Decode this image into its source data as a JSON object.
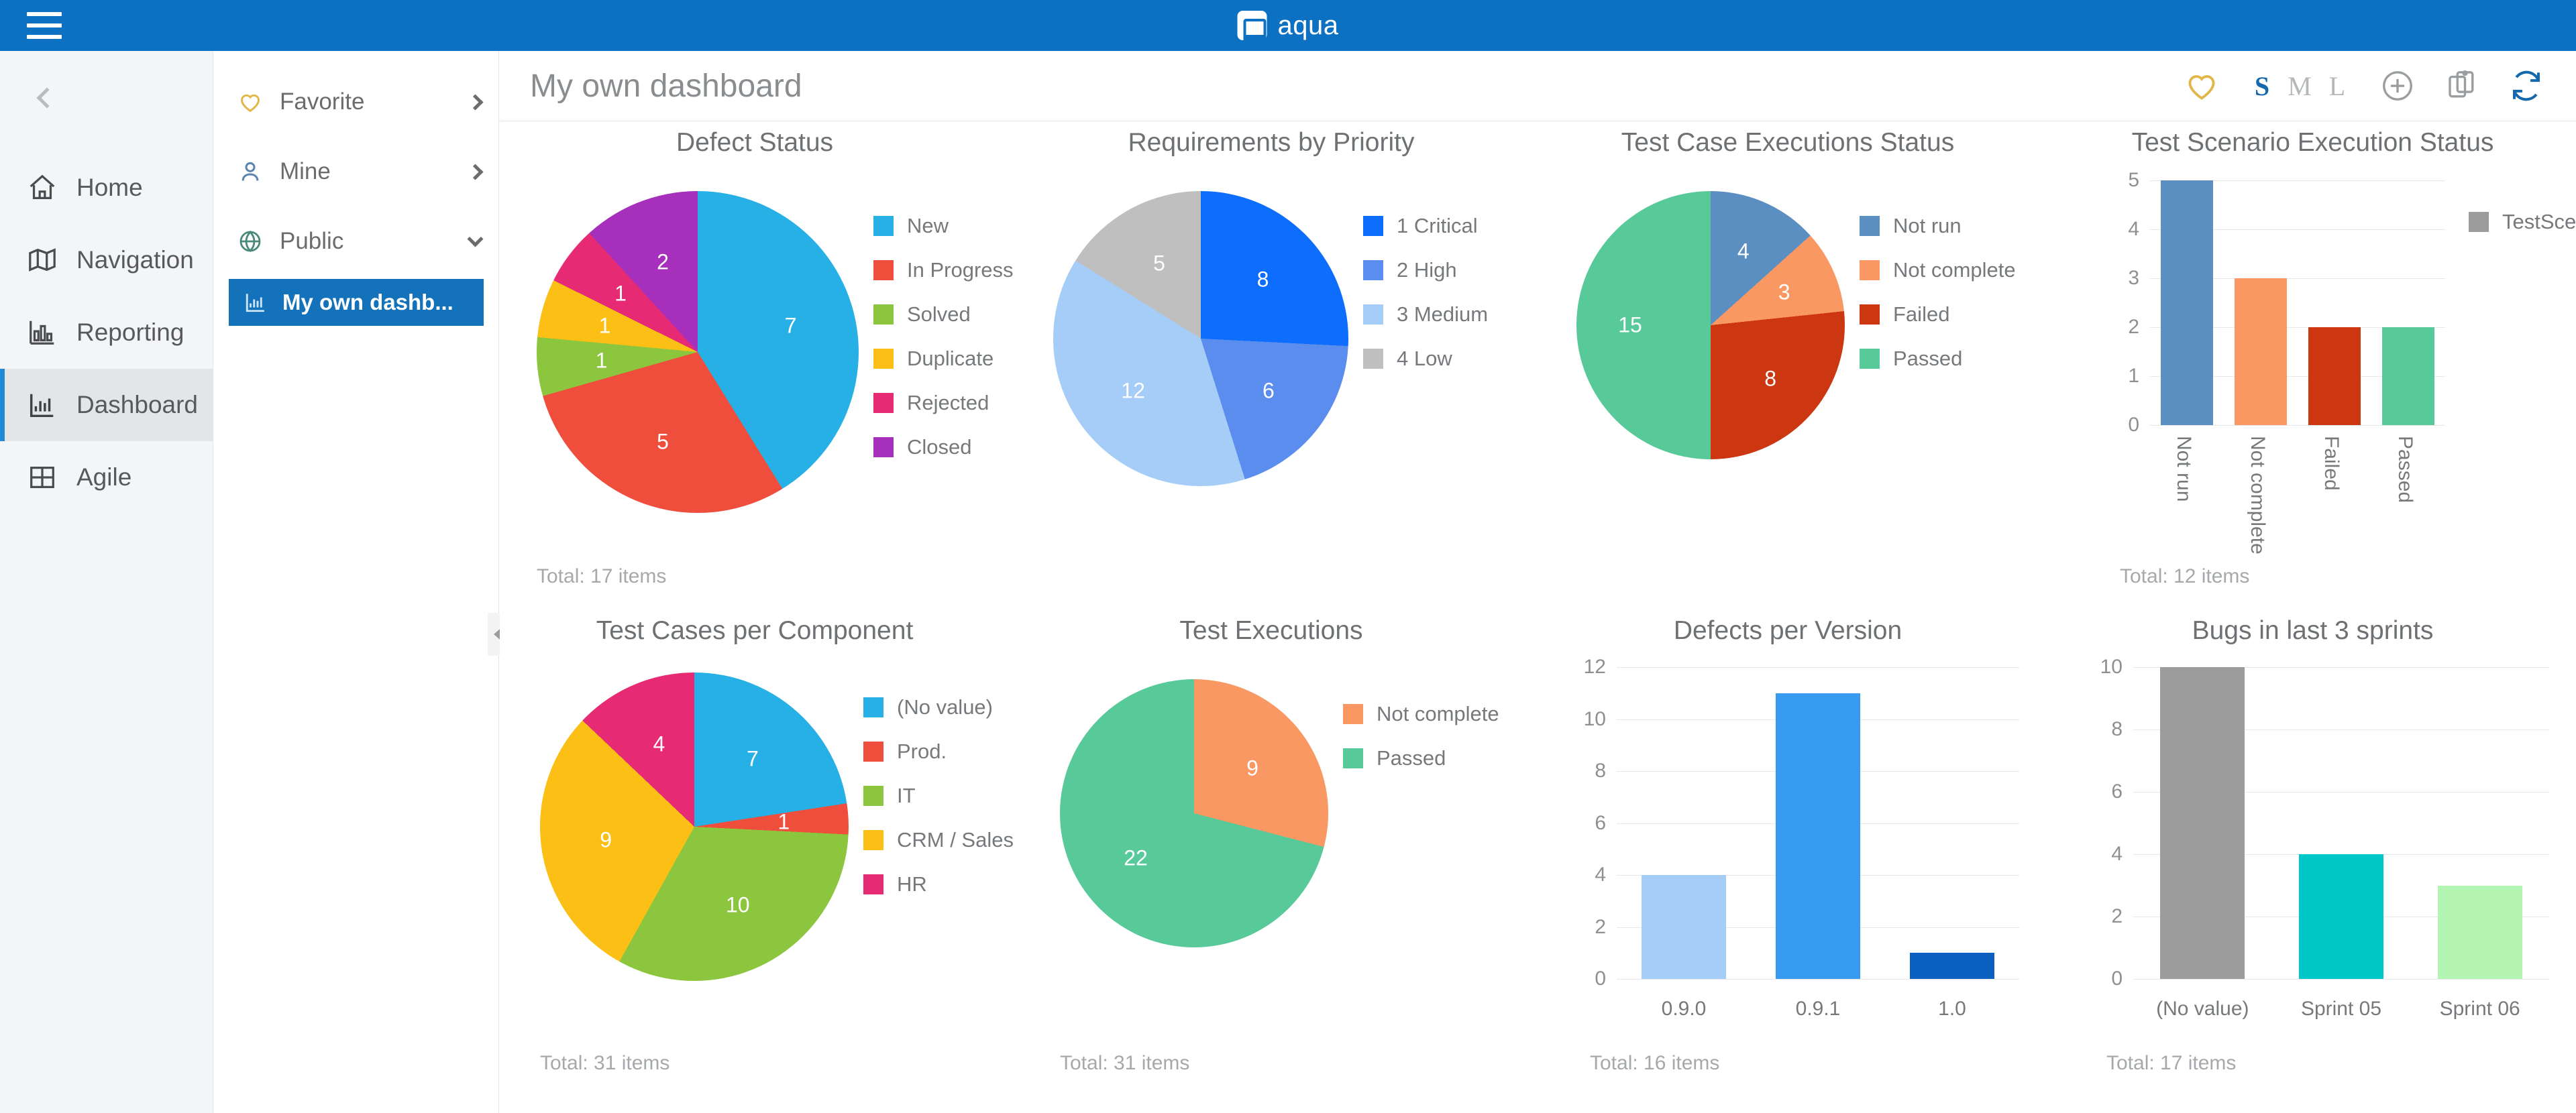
{
  "app": {
    "name": "aqua",
    "logo_icon": "aqua-logo-icon",
    "menu_icon": "hamburger-icon"
  },
  "rail": {
    "collapse_icon": "chevron-left-icon",
    "items": [
      {
        "label": "Home",
        "icon": "home-icon",
        "active": false
      },
      {
        "label": "Navigation",
        "icon": "map-icon",
        "active": false
      },
      {
        "label": "Reporting",
        "icon": "report-icon",
        "active": false
      },
      {
        "label": "Dashboard",
        "icon": "bar-chart-icon",
        "active": true
      },
      {
        "label": "Agile",
        "icon": "grid-icon",
        "active": false
      }
    ]
  },
  "tree": {
    "groups": [
      {
        "label": "Favorite",
        "icon": "heart-icon",
        "state": "collapsed",
        "caret": "chevron-right-icon"
      },
      {
        "label": "Mine",
        "icon": "user-icon",
        "state": "collapsed",
        "caret": "chevron-right-icon"
      },
      {
        "label": "Public",
        "icon": "globe-icon",
        "state": "expanded",
        "caret": "chevron-down-icon"
      }
    ],
    "selected_item": {
      "label": "My own dashb...",
      "icon": "bar-chart-icon"
    },
    "panel_collapse_icon": "triangle-left-icon"
  },
  "header": {
    "title": "My own dashboard",
    "favorite_icon": "heart-icon",
    "sizes": [
      {
        "label": "S",
        "active": true
      },
      {
        "label": "M",
        "active": false
      },
      {
        "label": "L",
        "active": false
      }
    ],
    "actions": [
      {
        "name": "add-widget-button",
        "icon": "plus-circle-icon"
      },
      {
        "name": "copy-dashboard-button",
        "icon": "copy-icon"
      },
      {
        "name": "refresh-button",
        "icon": "refresh-icon"
      }
    ]
  },
  "chart_data": [
    {
      "id": "defect-status",
      "type": "pie",
      "title": "Defect Status",
      "total_label": "Total: 17 items",
      "categories": [
        "New",
        "In Progress",
        "Solved",
        "Duplicate",
        "Rejected",
        "Closed"
      ],
      "values": [
        7,
        5,
        1,
        1,
        1,
        2
      ],
      "colors": [
        "#26b0e6",
        "#ef4e3c",
        "#8cc council",
        "#fbbf16",
        "#e62a74",
        "#a630bb"
      ],
      "legend_position": "right"
    },
    {
      "id": "requirements-by-priority",
      "type": "pie",
      "title": "Requirements by Priority",
      "total_label": "",
      "categories": [
        "1 Critical",
        "2 High",
        "3 Medium",
        "4 Low"
      ],
      "values": [
        8,
        6,
        12,
        5
      ],
      "colors": [
        "#0d6efd",
        "#5b8dee",
        "#a5cdf7",
        "#bfbfbf"
      ],
      "legend_position": "right"
    },
    {
      "id": "test-case-executions-status",
      "type": "pie",
      "title": "Test Case Executions Status",
      "total_label": "",
      "categories": [
        "Not run",
        "Not complete",
        "Failed",
        "Passed"
      ],
      "values": [
        4,
        3,
        8,
        15
      ],
      "colors": [
        "#5b8fc2",
        "#f99862",
        "#cc3711",
        "#58c999"
      ],
      "legend_position": "right"
    },
    {
      "id": "test-scenario-execution-status",
      "type": "bar",
      "title": "Test Scenario Execution Status",
      "total_label": "Total: 12 items",
      "categories": [
        "Not run",
        "Not complete",
        "Failed",
        "Passed"
      ],
      "values": [
        5,
        3,
        2,
        2
      ],
      "colors": [
        "#5b8fc2",
        "#f99862",
        "#cc3711",
        "#58c999"
      ],
      "ylim": [
        0,
        5
      ],
      "yticks": [
        0,
        1,
        2,
        3,
        4,
        5
      ],
      "legend": [
        {
          "label": "TestScenario",
          "color": "#9c9c9c"
        }
      ],
      "xlabel_rotated": true
    },
    {
      "id": "test-cases-per-component",
      "type": "pie",
      "title": "Test Cases per Component",
      "total_label": "Total: 31 items",
      "categories": [
        "(No value)",
        "Prod.",
        "IT",
        "CRM / Sales",
        "HR"
      ],
      "values": [
        7,
        1,
        10,
        9,
        4
      ],
      "colors": [
        "#26b0e6",
        "#ef4e3c",
        "#8cc63e",
        "#fbbf16",
        "#e62a74"
      ],
      "legend_position": "right"
    },
    {
      "id": "test-executions",
      "type": "pie",
      "title": "Test Executions",
      "total_label": "Total: 31 items",
      "categories": [
        "Not complete",
        "Passed"
      ],
      "values": [
        9,
        22
      ],
      "colors": [
        "#f99862",
        "#58c999"
      ],
      "legend_position": "right"
    },
    {
      "id": "defects-per-version",
      "type": "bar",
      "title": "Defects per Version",
      "total_label": "Total: 16 items",
      "categories": [
        "0.9.0",
        "0.9.1",
        "1.0"
      ],
      "values": [
        4,
        11,
        1
      ],
      "colors": [
        "#a5cdf7",
        "#389bf2",
        "#0a5fc0"
      ],
      "ylim": [
        0,
        12
      ],
      "yticks": [
        0,
        2,
        4,
        6,
        8,
        10,
        12
      ],
      "xlabel_rotated": false
    },
    {
      "id": "bugs-in-last-3-sprints",
      "type": "bar",
      "title": "Bugs in last 3 sprints",
      "total_label": "Total: 17 items",
      "categories": [
        "(No value)",
        "Sprint 05",
        "Sprint 06"
      ],
      "values": [
        10,
        4,
        3
      ],
      "colors": [
        "#9c9c9c",
        "#00c8c8",
        "#b4f5b4"
      ],
      "ylim": [
        0,
        10
      ],
      "yticks": [
        0,
        2,
        4,
        6,
        8,
        10
      ],
      "xlabel_rotated": false
    }
  ]
}
